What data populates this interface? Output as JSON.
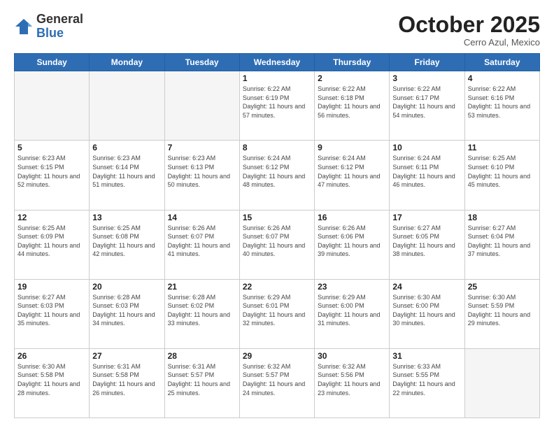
{
  "header": {
    "logo_general": "General",
    "logo_blue": "Blue",
    "month_title": "October 2025",
    "subtitle": "Cerro Azul, Mexico"
  },
  "days_of_week": [
    "Sunday",
    "Monday",
    "Tuesday",
    "Wednesday",
    "Thursday",
    "Friday",
    "Saturday"
  ],
  "weeks": [
    [
      {
        "day": "",
        "sunrise": "",
        "sunset": "",
        "daylight": "",
        "empty": true
      },
      {
        "day": "",
        "sunrise": "",
        "sunset": "",
        "daylight": "",
        "empty": true
      },
      {
        "day": "",
        "sunrise": "",
        "sunset": "",
        "daylight": "",
        "empty": true
      },
      {
        "day": "1",
        "sunrise": "Sunrise: 6:22 AM",
        "sunset": "Sunset: 6:19 PM",
        "daylight": "Daylight: 11 hours and 57 minutes."
      },
      {
        "day": "2",
        "sunrise": "Sunrise: 6:22 AM",
        "sunset": "Sunset: 6:18 PM",
        "daylight": "Daylight: 11 hours and 56 minutes."
      },
      {
        "day": "3",
        "sunrise": "Sunrise: 6:22 AM",
        "sunset": "Sunset: 6:17 PM",
        "daylight": "Daylight: 11 hours and 54 minutes."
      },
      {
        "day": "4",
        "sunrise": "Sunrise: 6:22 AM",
        "sunset": "Sunset: 6:16 PM",
        "daylight": "Daylight: 11 hours and 53 minutes."
      }
    ],
    [
      {
        "day": "5",
        "sunrise": "Sunrise: 6:23 AM",
        "sunset": "Sunset: 6:15 PM",
        "daylight": "Daylight: 11 hours and 52 minutes."
      },
      {
        "day": "6",
        "sunrise": "Sunrise: 6:23 AM",
        "sunset": "Sunset: 6:14 PM",
        "daylight": "Daylight: 11 hours and 51 minutes."
      },
      {
        "day": "7",
        "sunrise": "Sunrise: 6:23 AM",
        "sunset": "Sunset: 6:13 PM",
        "daylight": "Daylight: 11 hours and 50 minutes."
      },
      {
        "day": "8",
        "sunrise": "Sunrise: 6:24 AM",
        "sunset": "Sunset: 6:12 PM",
        "daylight": "Daylight: 11 hours and 48 minutes."
      },
      {
        "day": "9",
        "sunrise": "Sunrise: 6:24 AM",
        "sunset": "Sunset: 6:12 PM",
        "daylight": "Daylight: 11 hours and 47 minutes."
      },
      {
        "day": "10",
        "sunrise": "Sunrise: 6:24 AM",
        "sunset": "Sunset: 6:11 PM",
        "daylight": "Daylight: 11 hours and 46 minutes."
      },
      {
        "day": "11",
        "sunrise": "Sunrise: 6:25 AM",
        "sunset": "Sunset: 6:10 PM",
        "daylight": "Daylight: 11 hours and 45 minutes."
      }
    ],
    [
      {
        "day": "12",
        "sunrise": "Sunrise: 6:25 AM",
        "sunset": "Sunset: 6:09 PM",
        "daylight": "Daylight: 11 hours and 44 minutes."
      },
      {
        "day": "13",
        "sunrise": "Sunrise: 6:25 AM",
        "sunset": "Sunset: 6:08 PM",
        "daylight": "Daylight: 11 hours and 42 minutes."
      },
      {
        "day": "14",
        "sunrise": "Sunrise: 6:26 AM",
        "sunset": "Sunset: 6:07 PM",
        "daylight": "Daylight: 11 hours and 41 minutes."
      },
      {
        "day": "15",
        "sunrise": "Sunrise: 6:26 AM",
        "sunset": "Sunset: 6:07 PM",
        "daylight": "Daylight: 11 hours and 40 minutes."
      },
      {
        "day": "16",
        "sunrise": "Sunrise: 6:26 AM",
        "sunset": "Sunset: 6:06 PM",
        "daylight": "Daylight: 11 hours and 39 minutes."
      },
      {
        "day": "17",
        "sunrise": "Sunrise: 6:27 AM",
        "sunset": "Sunset: 6:05 PM",
        "daylight": "Daylight: 11 hours and 38 minutes."
      },
      {
        "day": "18",
        "sunrise": "Sunrise: 6:27 AM",
        "sunset": "Sunset: 6:04 PM",
        "daylight": "Daylight: 11 hours and 37 minutes."
      }
    ],
    [
      {
        "day": "19",
        "sunrise": "Sunrise: 6:27 AM",
        "sunset": "Sunset: 6:03 PM",
        "daylight": "Daylight: 11 hours and 35 minutes."
      },
      {
        "day": "20",
        "sunrise": "Sunrise: 6:28 AM",
        "sunset": "Sunset: 6:03 PM",
        "daylight": "Daylight: 11 hours and 34 minutes."
      },
      {
        "day": "21",
        "sunrise": "Sunrise: 6:28 AM",
        "sunset": "Sunset: 6:02 PM",
        "daylight": "Daylight: 11 hours and 33 minutes."
      },
      {
        "day": "22",
        "sunrise": "Sunrise: 6:29 AM",
        "sunset": "Sunset: 6:01 PM",
        "daylight": "Daylight: 11 hours and 32 minutes."
      },
      {
        "day": "23",
        "sunrise": "Sunrise: 6:29 AM",
        "sunset": "Sunset: 6:00 PM",
        "daylight": "Daylight: 11 hours and 31 minutes."
      },
      {
        "day": "24",
        "sunrise": "Sunrise: 6:30 AM",
        "sunset": "Sunset: 6:00 PM",
        "daylight": "Daylight: 11 hours and 30 minutes."
      },
      {
        "day": "25",
        "sunrise": "Sunrise: 6:30 AM",
        "sunset": "Sunset: 5:59 PM",
        "daylight": "Daylight: 11 hours and 29 minutes."
      }
    ],
    [
      {
        "day": "26",
        "sunrise": "Sunrise: 6:30 AM",
        "sunset": "Sunset: 5:58 PM",
        "daylight": "Daylight: 11 hours and 28 minutes."
      },
      {
        "day": "27",
        "sunrise": "Sunrise: 6:31 AM",
        "sunset": "Sunset: 5:58 PM",
        "daylight": "Daylight: 11 hours and 26 minutes."
      },
      {
        "day": "28",
        "sunrise": "Sunrise: 6:31 AM",
        "sunset": "Sunset: 5:57 PM",
        "daylight": "Daylight: 11 hours and 25 minutes."
      },
      {
        "day": "29",
        "sunrise": "Sunrise: 6:32 AM",
        "sunset": "Sunset: 5:57 PM",
        "daylight": "Daylight: 11 hours and 24 minutes."
      },
      {
        "day": "30",
        "sunrise": "Sunrise: 6:32 AM",
        "sunset": "Sunset: 5:56 PM",
        "daylight": "Daylight: 11 hours and 23 minutes."
      },
      {
        "day": "31",
        "sunrise": "Sunrise: 6:33 AM",
        "sunset": "Sunset: 5:55 PM",
        "daylight": "Daylight: 11 hours and 22 minutes."
      },
      {
        "day": "",
        "sunrise": "",
        "sunset": "",
        "daylight": "",
        "empty": true
      }
    ]
  ]
}
